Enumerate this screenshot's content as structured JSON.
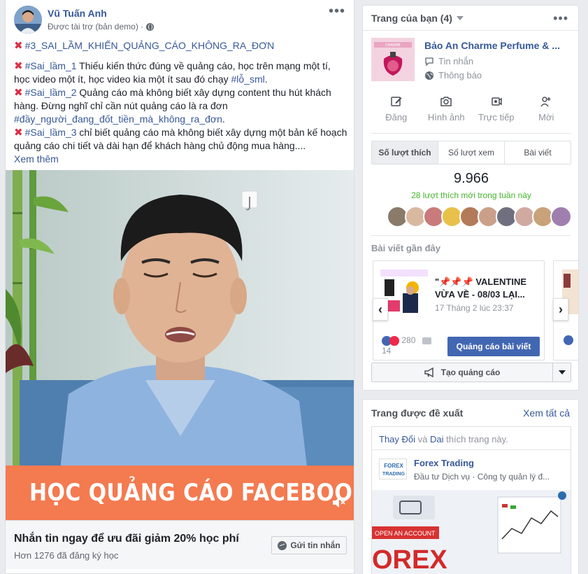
{
  "post": {
    "author": "Vũ Tuấn Anh",
    "sponsored": "Được tài trợ (bản demo) ·",
    "title_tag": "#3_SAI_LẦM_KHIẾN_QUẢNG_CÁO_KHÔNG_RA_ĐƠN",
    "item1_tag": "#Sai_lầm_1",
    "item1_text": "Thiếu kiến thức đúng về quảng cáo, học trên mạng một tí, học video một ít, học video kia một ít sau đó chạy",
    "item1_tag2": "#lỗ_sml",
    "item1_end": ".",
    "item2_tag": "#Sai_lầm_2",
    "item2_text": "Quảng cáo mà không biết xây dựng content thu hút khách hàng. Đừng nghĩ chỉ cần nút quảng cáo là ra đơn",
    "item2_tag2": "#đầy_người_đang_đốt_tiền_mà_không_ra_đơn",
    "item2_end": ".",
    "item3_tag": "#Sai_lầm_3",
    "item3_text": "chỉ biết quảng cáo mà không biết xây dựng một bản kế hoạch quảng cáo chi tiết và dài hạn để khách hàng chủ động mua hàng....",
    "see_more": "Xem thêm",
    "banner": "HỌC QUẢNG CÁO FACEBOOK",
    "cta_title": "Nhắn tin ngay để ưu đãi giảm 20% học phí",
    "cta_sub": "Hơn 1276 đã đăng ký học",
    "cta_button": "Gửi tin nhắn"
  },
  "pages_panel": {
    "header": "Trang của bạn (4)",
    "page_name": "Bảo An Charme Perfume & ...",
    "link_messages": "Tin nhắn",
    "link_notifications": "Thông báo",
    "actions": [
      "Đăng",
      "Hình ảnh",
      "Trực tiếp",
      "Mời"
    ],
    "tabs": [
      "Số lượt thích",
      "Số lượt xem",
      "Bài viết"
    ],
    "likes_count": "9.966",
    "weekly_likes": "28 lượt thích mới trong tuần này",
    "recent_label": "Bài viết gần đây",
    "recent_post": {
      "title": "\"📌📌📌 VALENTINE VỪA VỀ - 08/03 LẠI...",
      "date": "17 Tháng 2 lúc 23:37",
      "reactions": "280",
      "comments": "14",
      "boost_button": "Quảng cáo bài viết"
    },
    "create_ad": "Tạo quảng cáo"
  },
  "suggested_panel": {
    "title": "Trang được đề xuất",
    "see_all": "Xem tất cả",
    "friend1": "Thay Đổi",
    "friend_and": "và",
    "friend2": "Dai",
    "friends_suffix": "thích trang này.",
    "page_name": "Forex Trading",
    "page_category": "Đầu tư Dịch vụ · Công ty quản lý đ...",
    "ad_line1": "OPEN AN ACCOUNT",
    "ad_word": "OREX",
    "ad_logo": "FOREX TRADING"
  },
  "colors": {
    "link": "#365899",
    "accent_blue": "#4267b2",
    "banner_orange": "#f47a50",
    "green": "#42b72a",
    "red_x": "#dd2e44"
  }
}
